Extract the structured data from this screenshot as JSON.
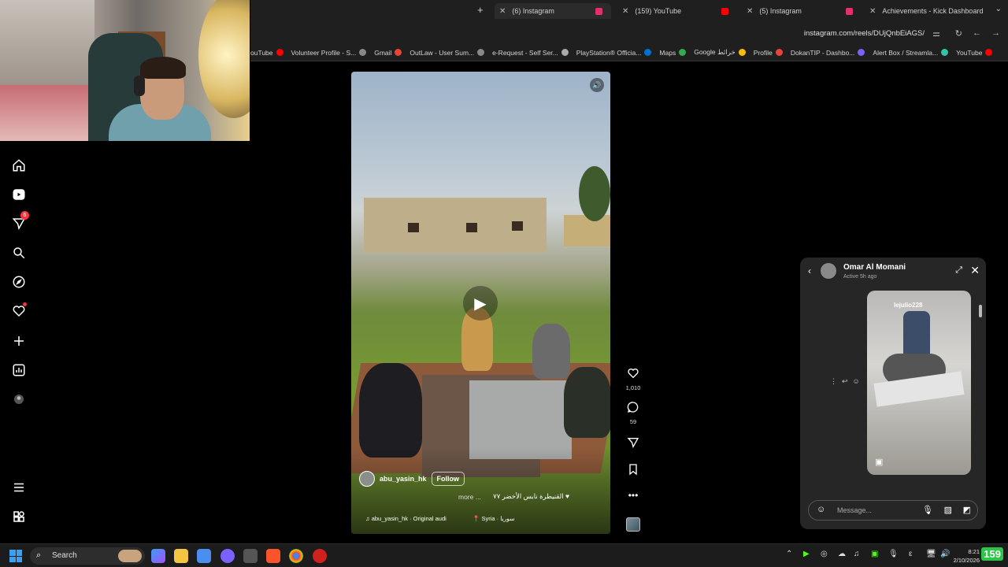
{
  "tabs": [
    {
      "label": "(6) Instagram",
      "active": true,
      "color": "#e1306c"
    },
    {
      "label": "(159) YouTube",
      "active": false,
      "color": "#ff0000"
    },
    {
      "label": "(5) Instagram",
      "active": false,
      "color": "#e1306c"
    },
    {
      "label": "Achievements - Kick Dashboard",
      "active": false,
      "color": "#53fc18"
    }
  ],
  "url": "instagram.com/reels/DUjQnbEiAGS/",
  "bookmarks": [
    {
      "label": "ouTube",
      "color": "#ff0000"
    },
    {
      "label": "Volunteer Profile - S...",
      "color": "#888888"
    },
    {
      "label": "Gmail",
      "color": "#ea4335"
    },
    {
      "label": "OutLaw - User Sum...",
      "color": "#888888"
    },
    {
      "label": "e-Request - Self Ser...",
      "color": "#aaaaaa"
    },
    {
      "label": "PlayStation® Officia...",
      "color": "#0070d1"
    },
    {
      "label": "Maps",
      "color": "#34a853"
    },
    {
      "label": "Google خرائط",
      "color": "#fbbc05"
    },
    {
      "label": "Profile",
      "color": "#ea4335"
    },
    {
      "label": "DokanTIP - Dashbo...",
      "color": "#7b61ff"
    },
    {
      "label": "Alert Box / Streamla...",
      "color": "#31c3a2"
    },
    {
      "label": "YouTube",
      "color": "#ff0000"
    }
  ],
  "sidebar": {
    "notification_count": "6"
  },
  "reel": {
    "author": "abu_yasin_hk",
    "follow_label": "Follow",
    "caption": "القنيطرة نابس الأخضر ٧٧ ♥",
    "more_label": "more ...",
    "audio": "abu_yasin_hk · Original audi",
    "location": "Syria · سوريا",
    "likes": "1,010",
    "comments": "59"
  },
  "chat": {
    "name": "Omar Al Momani",
    "status": "Active 5h ago",
    "shared_user": "lejulio228",
    "message_placeholder": "Message..."
  },
  "taskbar": {
    "search_label": "Search",
    "time": "8:21",
    "date": "2/10/2026",
    "counter": "159"
  }
}
